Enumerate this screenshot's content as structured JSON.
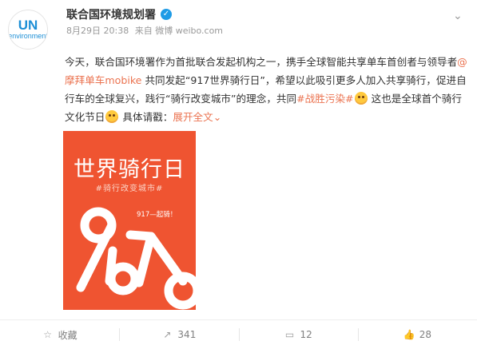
{
  "user": {
    "name": "联合国环境规划署",
    "avatar_top": "UN",
    "avatar_bottom": "environment"
  },
  "meta": {
    "date": "8月29日 20:38",
    "source": "来自 微博 weibo.com"
  },
  "post": {
    "p1": "今天，联合国环境署作为首批联合发起机构之一，携手全球智能共享单车首创者与领导者",
    "mention": "@摩拜单车mobike",
    "p2": " 共同发起“917世界骑行日”，希望以此吸引更多人加入共享骑行，促进自行车的全球复兴，践行“骑行改变城市”的理念，共同",
    "hashtag": "#战胜污染#",
    "p3": " 这也是全球首个骑行文化节日",
    "p4": " 具体请戳：",
    "expand": "展开全文",
    "expand_arrow": "⌄"
  },
  "poster": {
    "title": "世界骑行日",
    "subtitle": "#骑行改变城市#",
    "tag": "917—起骑！"
  },
  "actions": {
    "favorite": {
      "label": "收藏",
      "icon": "star-icon"
    },
    "repost": {
      "count": "341",
      "icon": "repost-icon"
    },
    "comment": {
      "count": "12",
      "icon": "comment-icon"
    },
    "like": {
      "count": "28",
      "icon": "thumbs-up-icon"
    }
  },
  "colors": {
    "accent": "#eb7350",
    "poster_bg": "#ef5431",
    "verified": "#1e9be6"
  }
}
